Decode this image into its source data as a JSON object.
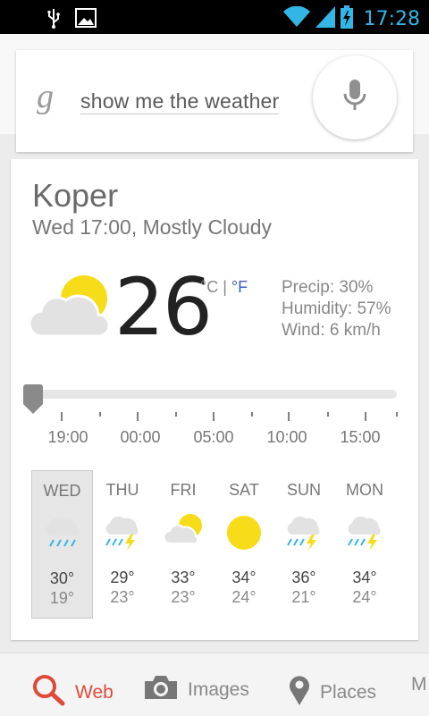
{
  "status_bar": {
    "time": "17:28",
    "time_color": "#33b5e5"
  },
  "search": {
    "query": "show me the weather",
    "logo": "google-g-logo",
    "mic": "microphone-icon"
  },
  "weather": {
    "city": "Koper",
    "condition_line": "Wed 17:00, Mostly Cloudy",
    "temperature": "26",
    "unit_c": "°C",
    "unit_sep": " | ",
    "unit_f": "°F",
    "precip": "Precip: 30%",
    "humidity": "Humidity: 57%",
    "wind": "Wind: 6 km/h",
    "hours": [
      "19:00",
      "00:00",
      "05:00",
      "10:00",
      "15:00"
    ],
    "days": [
      {
        "name": "WED",
        "hi": "30°",
        "lo": "19°",
        "icon": "rain-cloud-icon"
      },
      {
        "name": "THU",
        "hi": "29°",
        "lo": "23°",
        "icon": "thunderstorm-icon"
      },
      {
        "name": "FRI",
        "hi": "33°",
        "lo": "23°",
        "icon": "partly-cloudy-icon"
      },
      {
        "name": "SAT",
        "hi": "34°",
        "lo": "24°",
        "icon": "sun-icon"
      },
      {
        "name": "SUN",
        "hi": "36°",
        "lo": "21°",
        "icon": "thunderstorm-icon"
      },
      {
        "name": "MON",
        "hi": "34°",
        "lo": "24°",
        "icon": "thunderstorm-icon"
      }
    ]
  },
  "bottom_nav": {
    "web": "Web",
    "images": "Images",
    "places": "Places",
    "more": "M",
    "web_color": "#dd4b39"
  }
}
